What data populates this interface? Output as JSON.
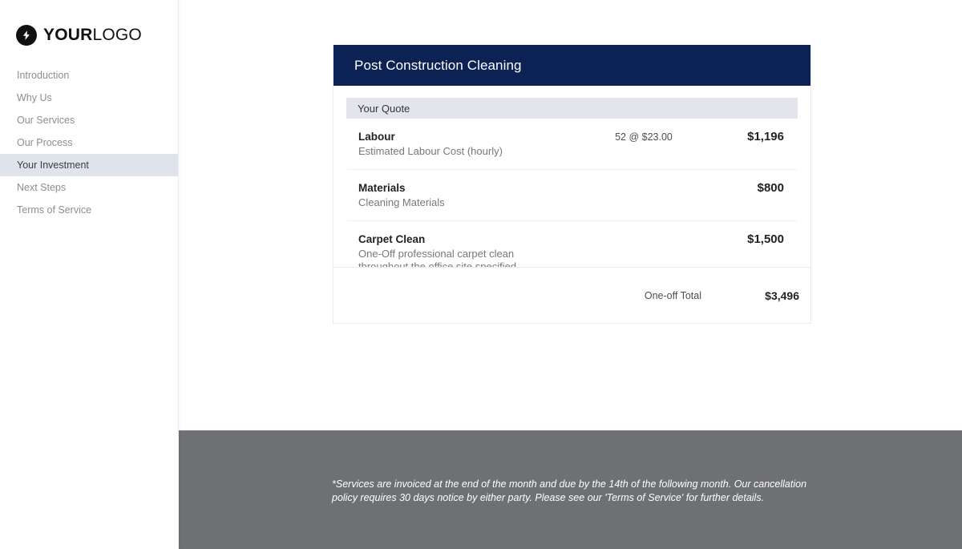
{
  "brand": {
    "logo_icon": "lightning-bolt-icon",
    "name_strong": "YOUR",
    "name_light": "LOGO"
  },
  "sidebar": {
    "items": [
      {
        "label": "Introduction",
        "active": false
      },
      {
        "label": "Why Us",
        "active": false
      },
      {
        "label": "Our Services",
        "active": false
      },
      {
        "label": "Our Process",
        "active": false
      },
      {
        "label": "Your Investment",
        "active": true
      },
      {
        "label": "Next Steps",
        "active": false
      },
      {
        "label": "Terms of Service",
        "active": false
      }
    ]
  },
  "quote": {
    "header_title": "Post Construction Cleaning",
    "section_label": "Your Quote",
    "line_items": [
      {
        "name": "Labour",
        "description": "Estimated Labour Cost (hourly)",
        "quantity": "52 @ $23.00",
        "amount": "$1,196"
      },
      {
        "name": "Materials",
        "description": "Cleaning Materials",
        "quantity": "",
        "amount": "$800"
      },
      {
        "name": "Carpet Clean",
        "description": "One-Off professional carpet clean\nthroughout the office site specified",
        "quantity": "",
        "amount": "$1,500"
      }
    ]
  },
  "total": {
    "label": "One-off Total",
    "amount": "$3,496"
  },
  "footer": {
    "note": "*Services are invoiced at the end of the month and due by the 14th of the following month. Our cancellation policy requires 30 days notice by either party. Please see our 'Terms of Service' for further details."
  },
  "colors": {
    "header_navy": "#0d2254",
    "subbar_gray": "#e2e6ec",
    "active_nav": "#dfe3ea",
    "footer_gray": "#6e7074"
  }
}
